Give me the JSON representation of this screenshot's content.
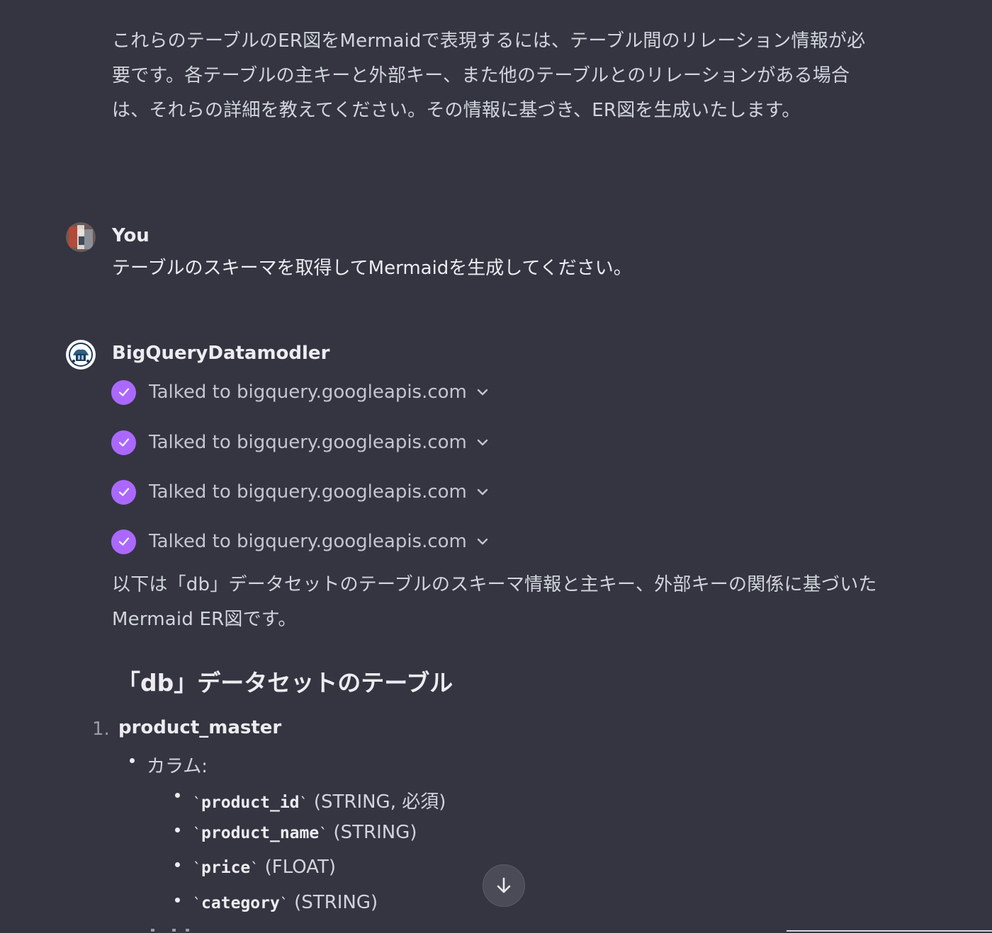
{
  "assistant_prev": {
    "text": "これらのテーブルのER図をMermaidで表現するには、テーブル間のリレーション情報が必要です。各テーブルの主キーと外部キー、また他のテーブルとのリレーションがある場合は、それらの詳細を教えてください。その情報に基づき、ER図を生成いたします。"
  },
  "user_message": {
    "author": "You",
    "text": "テーブルのスキーマを取得してMermaidを生成してください。"
  },
  "assistant_message": {
    "author": "BigQueryDatamodler",
    "tool_calls": [
      {
        "label": "Talked to bigquery.googleapis.com",
        "icon": "check-icon"
      },
      {
        "label": "Talked to bigquery.googleapis.com",
        "icon": "check-icon"
      },
      {
        "label": "Talked to bigquery.googleapis.com",
        "icon": "check-icon"
      },
      {
        "label": "Talked to bigquery.googleapis.com",
        "icon": "check-icon"
      }
    ],
    "intro": "以下は「db」データセットのテーブルのスキーマ情報と主キー、外部キーの関係に基づいたMermaid ER図です。",
    "heading": "「db」データセットのテーブル",
    "tables": [
      {
        "number": "1.",
        "name": "product_master",
        "columns_label": "カラム:",
        "columns": [
          {
            "name": "product_id",
            "type": "(STRING, 必須)"
          },
          {
            "name": "product_name",
            "type": "(STRING)"
          },
          {
            "name": "price",
            "type": "(FLOAT)"
          },
          {
            "name": "category",
            "type": "(STRING)"
          }
        ]
      }
    ]
  },
  "colors": {
    "background": "#343541",
    "check_accent": "#ab68ff",
    "text": "#ececf1"
  },
  "scroll_button": {
    "icon": "arrow-down-icon"
  }
}
